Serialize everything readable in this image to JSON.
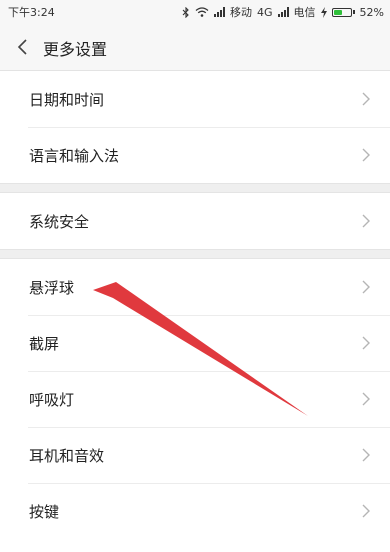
{
  "status_bar": {
    "time": "下午3:24",
    "carrier1": "移动",
    "network": "4G",
    "carrier2": "电信",
    "battery_text": "52%",
    "battery_level": 0.52,
    "battery_color": "#2fbf3a",
    "icons": [
      "bluetooth-icon",
      "wifi-icon",
      "signal-icon",
      "charging-icon",
      "battery-icon"
    ]
  },
  "header": {
    "title": "更多设置",
    "back_icon": "chevron-left-icon"
  },
  "sections": [
    {
      "items": [
        {
          "label": "日期和时间"
        },
        {
          "label": "语言和输入法"
        }
      ]
    },
    {
      "items": [
        {
          "label": "系统安全"
        }
      ]
    },
    {
      "items": [
        {
          "label": "悬浮球"
        },
        {
          "label": "截屏"
        },
        {
          "label": "呼吸灯"
        },
        {
          "label": "耳机和音效"
        },
        {
          "label": "按键"
        }
      ]
    }
  ],
  "annotation": {
    "type": "arrow",
    "color": "#e0393e",
    "points_to": "悬浮球"
  }
}
